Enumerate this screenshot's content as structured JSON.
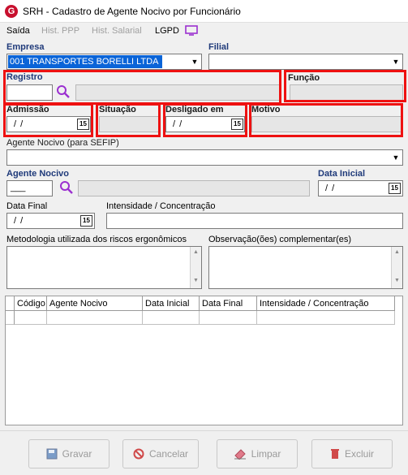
{
  "window": {
    "title": "SRH - Cadastro de Agente Nocivo por Funcionário",
    "icon": "srh-app-icon"
  },
  "menu": {
    "items": [
      "Saída",
      "Hist. PPP",
      "Hist. Salarial",
      "LGPD"
    ]
  },
  "labels": {
    "empresa": "Empresa",
    "filial": "Filial",
    "registro": "Registro",
    "funcao": "Função",
    "admissao": "Admissão",
    "situacao": "Situação",
    "desligado_em": "Desligado em",
    "motivo": "Motivo",
    "agente_nocivo_sefip": "Agente Nocivo (para SEFIP)",
    "agente_nocivo": "Agente Nocivo",
    "data_inicial": "Data Inicial",
    "data_final": "Data Final",
    "intensidade": "Intensidade /  Concentração",
    "metodologia": "Metodologia utilizada dos riscos ergonômicos",
    "observacao": "Observação(ões) complementar(es)"
  },
  "fields": {
    "empresa_value": "001 TRANSPORTES BORELLI LTDA",
    "admissao_value": "/ /",
    "desligado_value": "/ /",
    "agente_code_value": "___",
    "data_inicial_value": "/ /",
    "data_final_value": "/ /",
    "cal_glyph": "15"
  },
  "grid": {
    "columns": [
      "Código",
      "Agente Nocivo",
      "Data Inicial",
      "Data Final",
      "Intensidade /  Concentração"
    ]
  },
  "buttons": {
    "gravar": "Gravar",
    "cancelar": "Cancelar",
    "limpar": "Limpar",
    "excluir": "Excluir"
  },
  "colors": {
    "highlight": "#ee1111",
    "label_blue": "#1f3a7a",
    "selection": "#0a64d8",
    "search_icon": "#9b30d0"
  }
}
